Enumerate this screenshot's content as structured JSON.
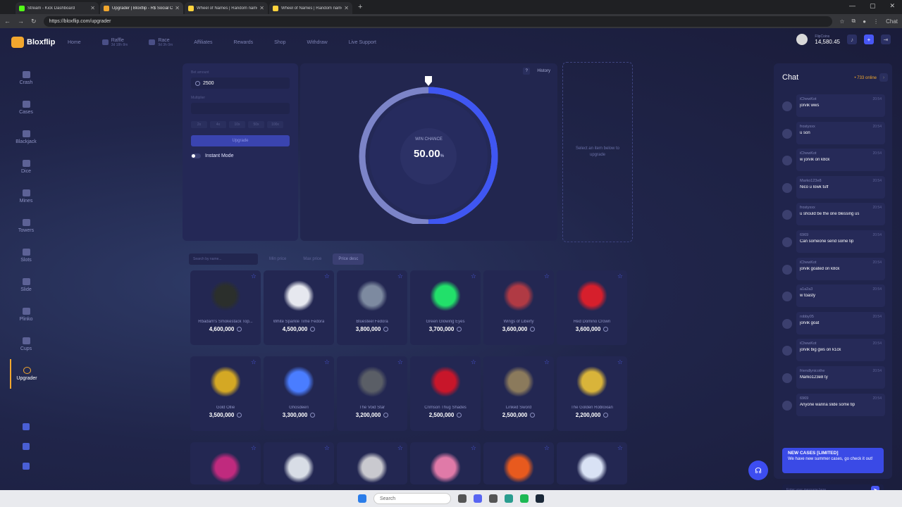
{
  "browser": {
    "tabs": [
      {
        "title": "Stream - Kick Dashboard",
        "color": "#53fc18"
      },
      {
        "title": "Upgrader | Bloxflip - R$ Social Casino",
        "color": "#f2a72e"
      },
      {
        "title": "Wheel of Names | Random name picker",
        "color": "#ffd33d"
      },
      {
        "title": "Wheel of Names | Random name picker",
        "color": "#ffd33d"
      }
    ],
    "url": "https://bloxflip.com/upgrader",
    "new_tab": "+",
    "chat_label": "Chat"
  },
  "app": {
    "logo": "Bloxflip",
    "nav": [
      {
        "label": "Home",
        "sub": ""
      },
      {
        "label": "Raffle",
        "sub": "3d 18h 8m"
      },
      {
        "label": "Race",
        "sub": "9d 3h 0m"
      },
      {
        "label": "Affiliates",
        "sub": ""
      },
      {
        "label": "Rewards",
        "sub": ""
      },
      {
        "label": "Shop",
        "sub": ""
      },
      {
        "label": "Withdraw",
        "sub": ""
      },
      {
        "label": "Live Support",
        "sub": ""
      }
    ],
    "account": {
      "coins_label": "FlipCoins",
      "balance": "14,580.45"
    }
  },
  "sidebar": [
    {
      "label": "Crash",
      "icon": "rocket-icon"
    },
    {
      "label": "Cases",
      "icon": "cases-icon"
    },
    {
      "label": "Blackjack",
      "icon": "cards-icon"
    },
    {
      "label": "Dice",
      "icon": "dice-icon"
    },
    {
      "label": "Mines",
      "icon": "mines-icon"
    },
    {
      "label": "Towers",
      "icon": "towers-icon"
    },
    {
      "label": "Slots",
      "icon": "slots-icon"
    },
    {
      "label": "Slide",
      "icon": "slide-icon"
    },
    {
      "label": "Plinko",
      "icon": "plinko-icon"
    },
    {
      "label": "Cups",
      "icon": "cups-icon"
    },
    {
      "label": "Upgrader",
      "icon": "upgrader-icon"
    }
  ],
  "upgrader": {
    "bet_label": "Bet amount",
    "bet_value": "2500",
    "multiplier_label": "Multiplier",
    "multipliers": [
      "2x",
      "4x",
      "10x",
      "50x",
      "100x"
    ],
    "upgrade_label": "Upgrade",
    "instant_label": "Instant Mode",
    "win_chance_label": "WIN CHANCE",
    "win_chance_value": "50.00",
    "win_chance_percent": 50,
    "history_label": "History",
    "help": "?",
    "target_hint": "Select an item below to upgrade"
  },
  "filters": {
    "search_placeholder": "Search by name...",
    "min_price": "Min price",
    "max_price": "Max price",
    "sort": "Price desc"
  },
  "items": [
    {
      "name": "Rbadam's Smokestack Top...",
      "price": "4,600,000",
      "color": "#2b2f2c"
    },
    {
      "name": "White Sparkle Time Fedora",
      "price": "4,500,000",
      "color": "#e6e8ef"
    },
    {
      "name": "Bluesteel Fedora",
      "price": "3,800,000",
      "color": "#7d8aa0"
    },
    {
      "name": "Green Glowing Eyes",
      "price": "3,700,000",
      "color": "#22e06a"
    },
    {
      "name": "Wings of Liberty",
      "price": "3,600,000",
      "color": "#b03a44"
    },
    {
      "name": "Red Domino Crown",
      "price": "3,600,000",
      "color": "#d61f2c"
    },
    {
      "name": "Gold Ollie",
      "price": "3,500,000",
      "color": "#d4a824"
    },
    {
      "name": "Ghosdeeri",
      "price": "3,300,000",
      "color": "#4a7dff"
    },
    {
      "name": "The Void Star",
      "price": "3,200,000",
      "color": "#5a5e66"
    },
    {
      "name": "Crimson Thug Shades",
      "price": "2,500,000",
      "color": "#c8162a"
    },
    {
      "name": "Linked Sword",
      "price": "2,500,000",
      "color": "#8b7a5c"
    },
    {
      "name": "The Golden Robloxian",
      "price": "2,200,000",
      "color": "#d9b43a"
    },
    {
      "name": "",
      "price": "",
      "color": "#c02a7e"
    },
    {
      "name": "",
      "price": "",
      "color": "#d8dde6"
    },
    {
      "name": "",
      "price": "",
      "color": "#c9c9cf"
    },
    {
      "name": "",
      "price": "",
      "color": "#e07aa8"
    },
    {
      "name": "",
      "price": "",
      "color": "#e85a1e"
    },
    {
      "name": "",
      "price": "",
      "color": "#d9e2f5"
    }
  ],
  "chat": {
    "title": "Chat",
    "online": "• 733 online",
    "messages": [
      {
        "user": "iChewKot",
        "time": "20:54",
        "text": "jorvik wws"
      },
      {
        "user": "frostyxxx",
        "time": "20:54",
        "text": "u son"
      },
      {
        "user": "iChewKot",
        "time": "20:54",
        "text": "w jorvik on k8ck"
      },
      {
        "user": "Marko123e8",
        "time": "20:54",
        "text": "Nico u lowk tuff"
      },
      {
        "user": "frostyxxx",
        "time": "20:54",
        "text": "u should be the one blessing us"
      },
      {
        "user": "6969",
        "time": "20:54",
        "text": "Can someone send some tip"
      },
      {
        "user": "iChewKot",
        "time": "20:54",
        "text": "jorvik goated on k8ck"
      },
      {
        "user": "a1a2a3",
        "time": "20:54",
        "text": "w toasty"
      },
      {
        "user": "robby05",
        "time": "20:54",
        "text": "jorvik goat"
      },
      {
        "user": "iChewKot",
        "time": "20:54",
        "text": "jorvik big gws on k1ck"
      },
      {
        "user": "friendlynicothe",
        "time": "20:54",
        "text": "Marko123e8 ty"
      },
      {
        "user": "6969",
        "time": "20:54",
        "text": "Anyone wanna slide some tip"
      }
    ],
    "promo_title": "NEW CASES [LIMITED]",
    "promo_text": "We have new summer cases, go check it out!",
    "input_placeholder": "Enter your message here..."
  },
  "taskbar": {
    "search": "Search"
  }
}
